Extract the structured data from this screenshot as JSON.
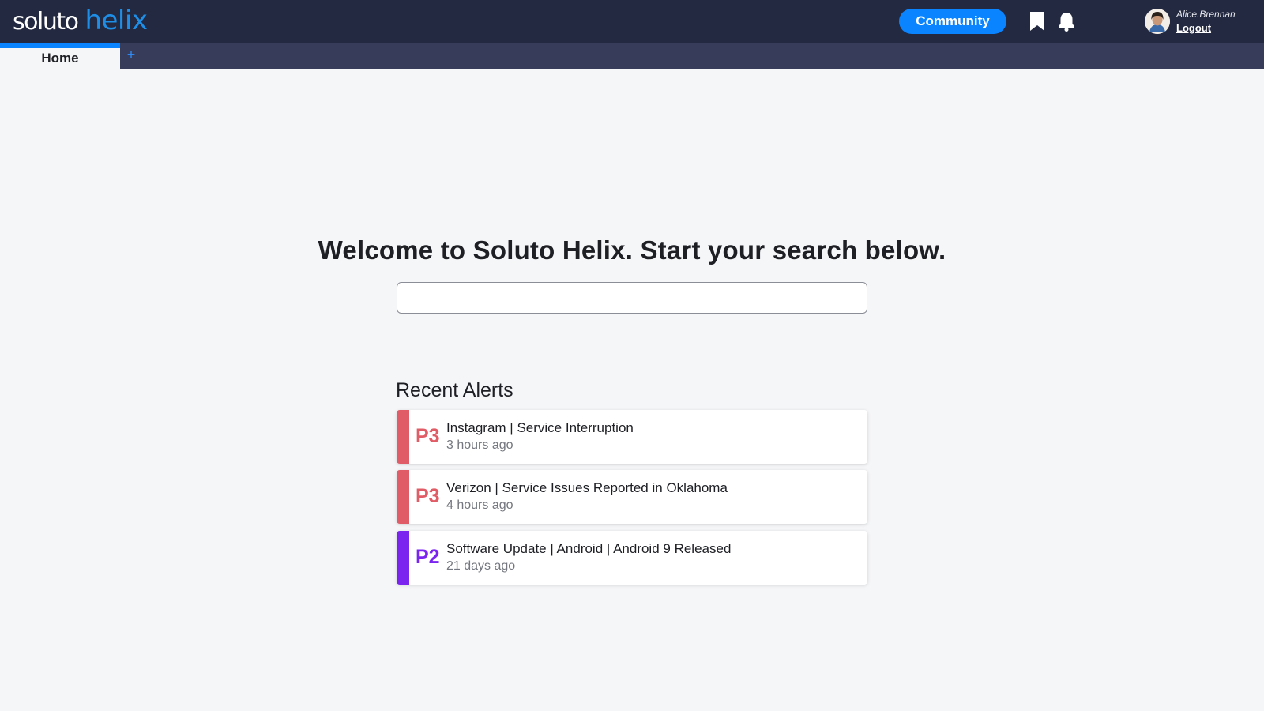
{
  "header": {
    "logo_primary": "soluto",
    "logo_secondary": "helix",
    "community_label": "Community",
    "user_name": "Alice.Brennan",
    "logout_label": "Logout",
    "icons": [
      "bookmark-icon",
      "bell-icon"
    ]
  },
  "tabs": {
    "home_label": "Home",
    "add_label": "+"
  },
  "main": {
    "welcome": "Welcome to Soluto Helix. Start your search below.",
    "search_value": "",
    "alerts_heading": "Recent Alerts"
  },
  "alerts": [
    {
      "priority": "P3",
      "title": "Instagram | Service Interruption",
      "time": "3 hours ago",
      "color": "#e05c66"
    },
    {
      "priority": "P3",
      "title": "Verizon | Service Issues Reported in Oklahoma",
      "time": "4 hours ago",
      "color": "#e05c66"
    },
    {
      "priority": "P2",
      "title": "Software Update | Android | Android 9 Released",
      "time": "21 days ago",
      "color": "#7b24f0"
    }
  ],
  "colors": {
    "topbar": "#232940",
    "tabbar": "#363c59",
    "accent": "#0a84ff",
    "p3": "#e05c66",
    "p2": "#7b24f0"
  }
}
